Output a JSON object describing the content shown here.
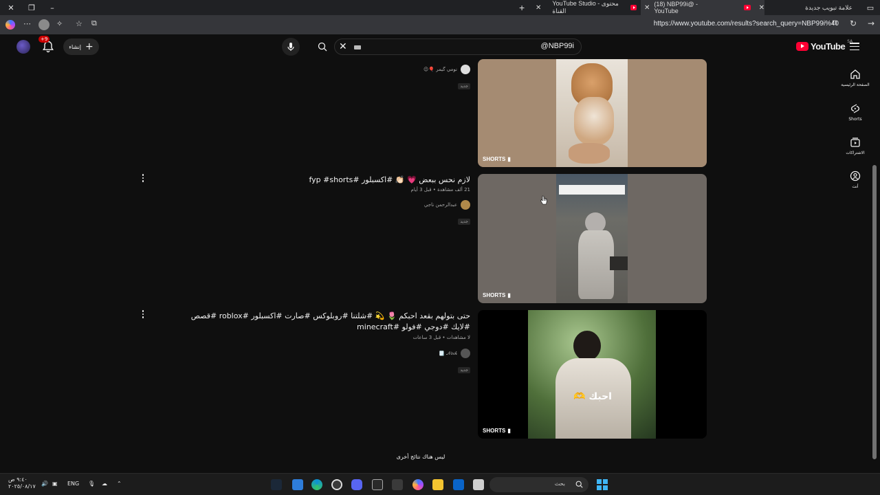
{
  "browser": {
    "tabs": [
      {
        "title": "علامة تبويب جديدة",
        "active": false
      },
      {
        "title": "(18) NBP99i@ - YouTube",
        "active": true
      },
      {
        "title": "YouTube Studio - محتوى القناة",
        "active": false
      }
    ],
    "url": "https://www.youtube.com/results?search_query=NBP99i%40"
  },
  "header": {
    "search_query": "@NBP99i",
    "create_label": "إنشاء",
    "notification_count": "+9",
    "logo_text": "YouTube",
    "logo_region": "SA"
  },
  "guide": {
    "items": [
      {
        "label": "الصفحة الرئيسية",
        "icon": "home-icon"
      },
      {
        "label": "Shorts",
        "icon": "shorts-icon"
      },
      {
        "label": "الاشتراكات",
        "icon": "subscriptions-icon"
      },
      {
        "label": "أنت",
        "icon": "you-icon"
      }
    ]
  },
  "results": [
    {
      "title": "",
      "meta": "",
      "channel": "نومي گيمر 🎈😉",
      "badge": "جديد",
      "tag": "SHORTS"
    },
    {
      "title": "لازم نحس ببعض 💗 👏🏻 #اكسبلور #fyp #shorts",
      "meta": "21 ألف مشاهدة • قبل 3 أيام",
      "channel": "عبدالرحمن ناجي",
      "badge": "جديد",
      "tag": "SHORTS"
    },
    {
      "title": "حتى بتولهم بقعد احبكم 🌷 💫 #شلتنا #روبلوكس #صارت #اكسبلور #roblox #قصص #لايك #دوجي #فولو #minecraft",
      "meta": "لا مشاهدات • قبل 3 ساعات",
      "channel": "𝒩𝑜𝒾𝒽 🗒️",
      "badge": "جديد",
      "tag": "SHORTS"
    }
  ],
  "thumb_overlay_text": "احبك 🫶",
  "end_message": "ليس هناك نتائج أخرى",
  "taskbar": {
    "time": "٩:٤٠ ص",
    "date": "٢٠٢٥/٠٨/١٧",
    "lang": "ENG",
    "search_placeholder": "بحث"
  },
  "colors": {
    "background": "#0f0f0f",
    "accent_red": "#ff0033",
    "text": "#f1f1f1",
    "muted": "#aaaaaa"
  }
}
